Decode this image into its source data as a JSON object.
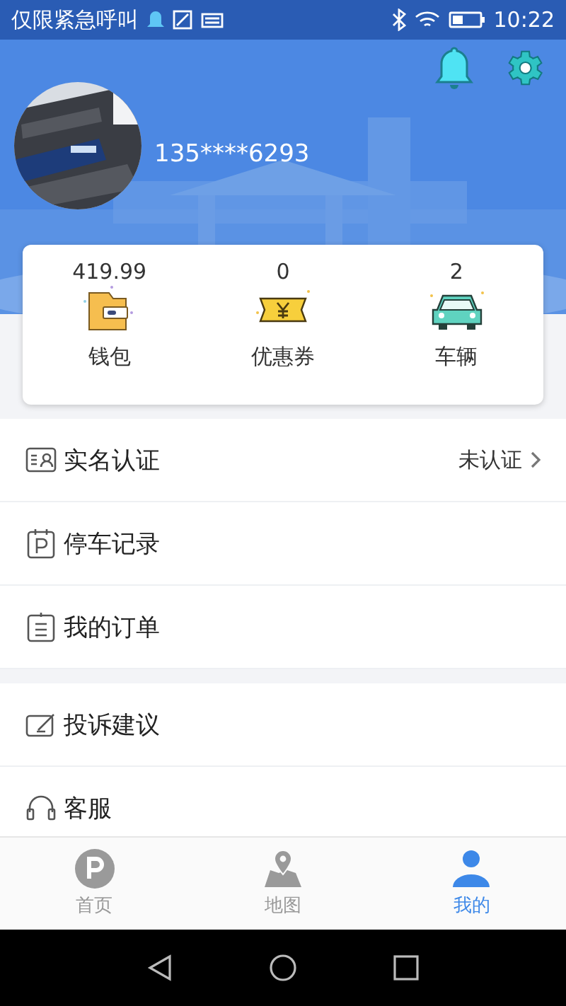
{
  "status_bar": {
    "notice": "仅限紧急呼叫",
    "time": "10:22"
  },
  "profile": {
    "phone": "135****6293"
  },
  "stats": [
    {
      "kind": "wallet",
      "value": "419.99",
      "label": "钱包"
    },
    {
      "kind": "coupon",
      "value": "0",
      "label": "优惠券"
    },
    {
      "kind": "car",
      "value": "2",
      "label": "车辆"
    }
  ],
  "menu_sections": [
    [
      {
        "kind": "id",
        "label": "实名认证",
        "value": "未认证"
      },
      {
        "kind": "parking",
        "label": "停车记录"
      },
      {
        "kind": "order",
        "label": "我的订单"
      }
    ],
    [
      {
        "kind": "feedback",
        "label": "投诉建议"
      },
      {
        "kind": "service",
        "label": "客服"
      }
    ]
  ],
  "tabs": [
    {
      "kind": "home",
      "label": "首页",
      "selected": false
    },
    {
      "kind": "map",
      "label": "地图",
      "selected": false
    },
    {
      "kind": "me",
      "label": "我的",
      "selected": true
    }
  ]
}
